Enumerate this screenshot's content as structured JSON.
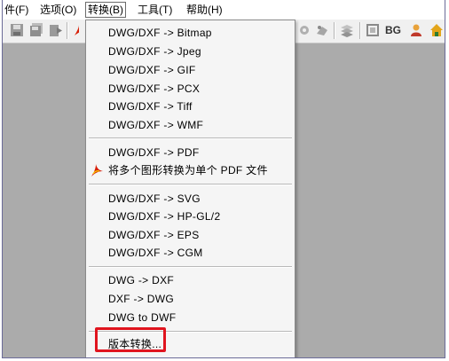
{
  "menubar": {
    "items": [
      {
        "label": "件(F)"
      },
      {
        "label": "选项(O)"
      },
      {
        "label": "转换(B)"
      },
      {
        "label": "工具(T)"
      },
      {
        "label": "帮助(H)"
      }
    ]
  },
  "toolbar": {
    "bg_label": "BG",
    "icons": [
      "save-icon",
      "save-all-icon",
      "export-icon",
      "pdf-convert-icon",
      "tool-icon",
      "tool-icon",
      "layers-icon",
      "frame-icon",
      "home-icon"
    ]
  },
  "convert_menu": {
    "items": [
      {
        "label": "DWG/DXF -> Bitmap"
      },
      {
        "label": "DWG/DXF -> Jpeg"
      },
      {
        "label": "DWG/DXF -> GIF"
      },
      {
        "label": "DWG/DXF -> PCX"
      },
      {
        "label": "DWG/DXF -> Tiff"
      },
      {
        "label": "DWG/DXF -> WMF"
      },
      {
        "label": "DWG/DXF -> PDF"
      },
      {
        "label": "将多个图形转换为单个 PDF 文件"
      },
      {
        "label": "DWG/DXF -> SVG"
      },
      {
        "label": "DWG/DXF -> HP-GL/2"
      },
      {
        "label": "DWG/DXF -> EPS"
      },
      {
        "label": "DWG/DXF -> CGM"
      },
      {
        "label": "DWG -> DXF"
      },
      {
        "label": "DXF -> DWG"
      },
      {
        "label": "DWG to DWF"
      },
      {
        "label": "版本转换..."
      }
    ]
  },
  "colors": {
    "highlight": "#e0141e",
    "canvas": "#ababab",
    "menu_bg": "#f5f5f5"
  }
}
